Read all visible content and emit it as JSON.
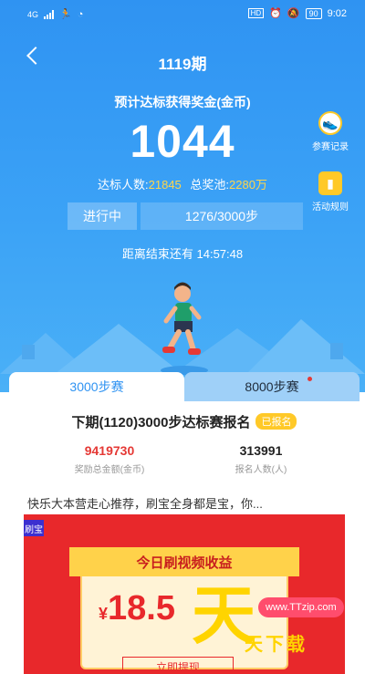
{
  "status_bar": {
    "network": "4G",
    "time": "9:02",
    "battery": "90"
  },
  "header": {
    "title": "1119期"
  },
  "hero": {
    "subtitle": "预计达标获得奖金(金币)",
    "amount": "1044",
    "reached_label": "达标人数:",
    "reached_value": "21845",
    "pool_label": "总奖池:",
    "pool_value": "2280万",
    "status_tag": "进行中",
    "progress_text": "1276/3000步",
    "countdown": "距离结束还有 14:57:48"
  },
  "side_buttons": [
    {
      "label": "参赛记录",
      "icon": "sneaker-icon"
    },
    {
      "label": "活动规则",
      "icon": "rulebook-icon"
    }
  ],
  "tabs": [
    {
      "label": "3000步赛",
      "active": true
    },
    {
      "label": "8000步赛",
      "active": false
    }
  ],
  "signup": {
    "title": "下期(1120)3000步达标赛报名",
    "badge": "已报名",
    "total_value": "9419730",
    "total_label": "奖励总金额(金币)",
    "people_value": "313991",
    "people_label": "报名人数(人)"
  },
  "news": {
    "headline": "快乐大本营走心推荐，刷宝全身都是宝，你..."
  },
  "ad": {
    "tag": "刷宝",
    "banner": "今日刷视频收益",
    "currency": "¥",
    "amount": "18.5",
    "button": "立即提现"
  },
  "watermark": {
    "url": "www.TTzip.com",
    "brand": "天下载",
    "glyph": "天"
  },
  "colors": {
    "primary_blue": "#2f93f2",
    "accent_yellow": "#ffd54a",
    "prize_red": "#e53935",
    "ad_red": "#e8282b"
  }
}
